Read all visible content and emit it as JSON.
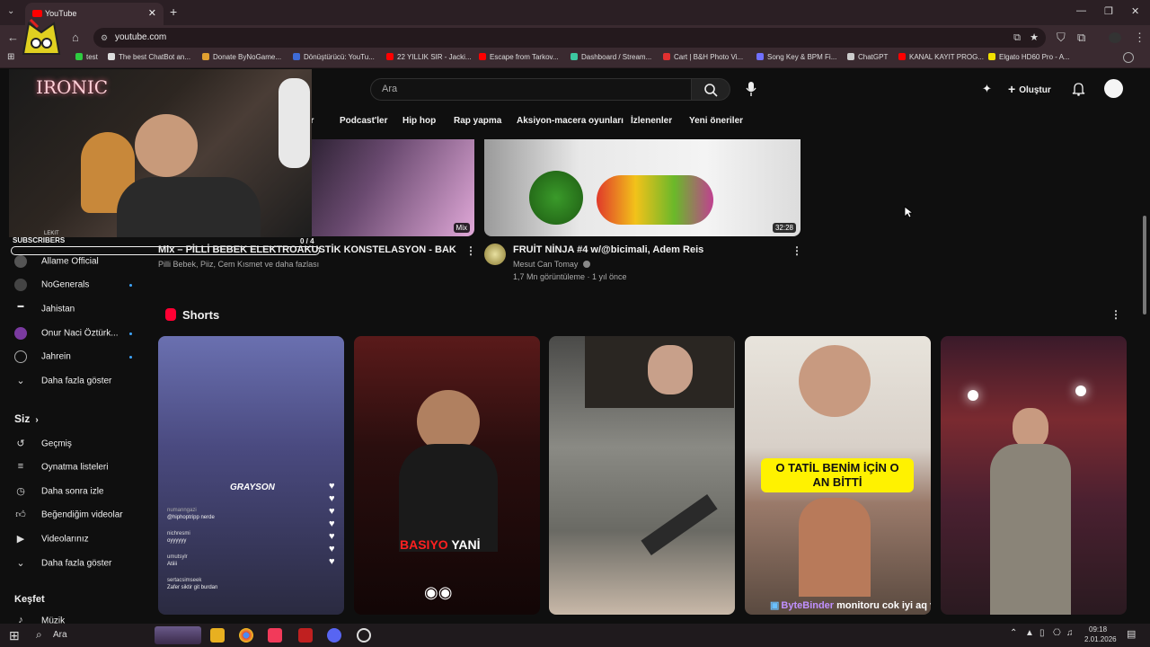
{
  "browser": {
    "tab_title": "YouTube",
    "new_tab": "+",
    "url": "youtube.com",
    "window_controls": [
      "—",
      "❐",
      "✕"
    ],
    "bookmarks": [
      {
        "label": "test",
        "color": "#2ecc40"
      },
      {
        "label": "The best ChatBot an...",
        "color": "#dddddd"
      },
      {
        "label": "Donate ByNoGame...",
        "color": "#e0a030"
      },
      {
        "label": "Dönüştürücü: YouTu...",
        "color": "#3e6bd6"
      },
      {
        "label": "22 YILLIK SIR - Jacki...",
        "color": "#ff0000"
      },
      {
        "label": "Escape from Tarkov...",
        "color": "#ff0000"
      },
      {
        "label": "Dashboard / Stream...",
        "color": "#3cc8a0"
      },
      {
        "label": "Cart | B&H Photo Vi...",
        "color": "#e03030"
      },
      {
        "label": "Song Key & BPM Fi...",
        "color": "#7070ff"
      },
      {
        "label": "ChatGPT",
        "color": "#cccccc"
      },
      {
        "label": "KANAL KAYIT PROG...",
        "color": "#ff0000"
      },
      {
        "label": "Elgato HD60 Pro - A...",
        "color": "#f0e000"
      }
    ]
  },
  "youtube": {
    "search_placeholder": "Ara",
    "create_label": "Oluştur",
    "chips": [
      "Podcast'ler",
      "Hip hop",
      "Rap yapma",
      "Aksiyon-macera oyunları",
      "İzlenenler",
      "Yeni öneriler"
    ],
    "chip_partial": "er"
  },
  "overlay": {
    "neon_text": "IRONIC",
    "subscribers_label": "SUBSCRIBERS",
    "subscribers_progress": "0 / 4",
    "subscribers_fraction": 0.0,
    "cam_name": "LEKIT"
  },
  "sidebar": {
    "subscriptions": [
      {
        "label": "Allame Official",
        "dot": false
      },
      {
        "label": "NoGenerals",
        "dot": true
      },
      {
        "label": "Jahistan",
        "dot": false
      },
      {
        "label": "Onur Naci Öztürk...",
        "dot": true
      },
      {
        "label": "Jahrein",
        "dot": true
      }
    ],
    "show_more": "Daha fazla göster",
    "you_section": "Siz",
    "you_items": [
      "Geçmiş",
      "Oynatma listeleri",
      "Daha sonra izle",
      "Beğendiğim videolar",
      "Videolarınız"
    ],
    "show_more_2": "Daha fazla göster",
    "explore_section": "Keşfet",
    "explore_items": [
      "Müzik"
    ]
  },
  "videos": [
    {
      "title": "Mix – PİLLİ BEBEK ELEKTROAKUSTİK KONSTELASYON - BAK",
      "meta1": "Pilli Bebek, Piiz, Cem Kısmet ve daha fazlası",
      "meta2": "",
      "badge": "Mix"
    },
    {
      "title": "FRUİT NİNJA #4 w/@bicimali, Adem Reis",
      "meta1": "Mesut Can Tomay",
      "meta2": "1,7 Mn görüntüleme · 1 yıl önce",
      "badge": "32:28"
    }
  ],
  "shorts": {
    "heading": "Shorts",
    "items": [
      {
        "caption": "GRAYSON",
        "comments": [
          {
            "user": "numanngazi",
            "text": "@hiphoptripp nerde"
          },
          {
            "user": "nichresmi",
            "text": "oyyyyyy"
          },
          {
            "user": "umutsylr",
            "text": "Atiiii"
          },
          {
            "user": "sertacsimseek",
            "text": "Zafer siktir git burdan"
          }
        ]
      },
      {
        "caption_red": "BASIYO",
        "caption_white": "YANİ"
      },
      {
        "caption": ""
      },
      {
        "caption": "O TATİL BENİM İÇİN O AN BİTTİ",
        "chat_user": "ByteBinder",
        "chat_text": "monitoru cok iyi aq ya"
      },
      {
        "caption": ""
      }
    ]
  },
  "taskbar": {
    "search": "Ara",
    "time": "09:18",
    "date": "2.01.2026"
  }
}
